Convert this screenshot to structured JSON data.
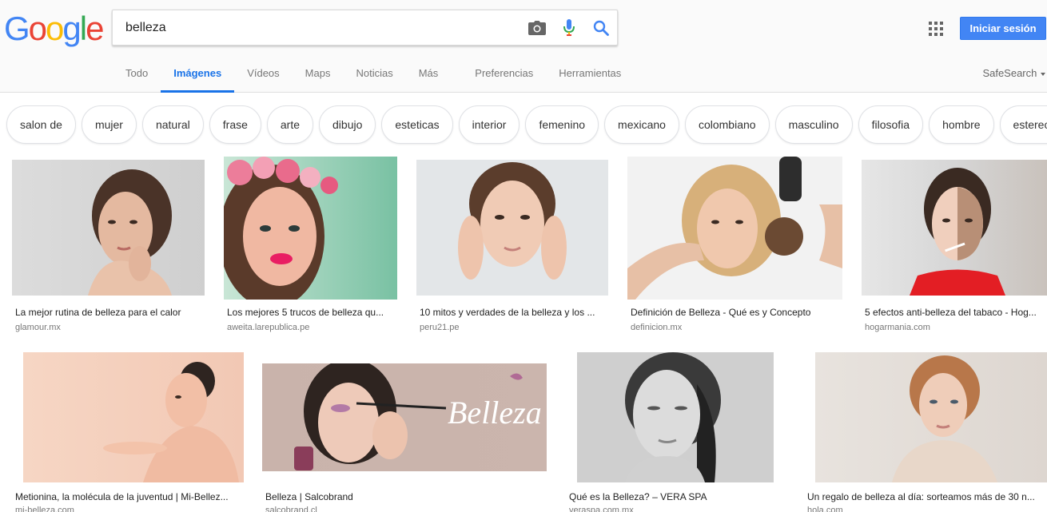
{
  "logo": {
    "letters": [
      "G",
      "o",
      "o",
      "g",
      "l",
      "e"
    ],
    "colors": [
      "#4285f4",
      "#ea4335",
      "#fbbc05",
      "#4285f4",
      "#34a853",
      "#ea4335"
    ]
  },
  "search": {
    "value": "belleza"
  },
  "header": {
    "signin_label": "Iniciar sesión",
    "safesearch_label": "SafeSearch"
  },
  "tabs": [
    {
      "label": "Todo"
    },
    {
      "label": "Imágenes",
      "active": true
    },
    {
      "label": "Vídeos"
    },
    {
      "label": "Maps"
    },
    {
      "label": "Noticias"
    },
    {
      "label": "Más"
    },
    {
      "label": "Preferencias"
    },
    {
      "label": "Herramientas"
    }
  ],
  "chips": [
    "salon de",
    "mujer",
    "natural",
    "frase",
    "arte",
    "dibujo",
    "esteticas",
    "interior",
    "femenino",
    "mexicano",
    "colombiano",
    "masculino",
    "filosofia",
    "hombre",
    "estereoti"
  ],
  "results": [
    {
      "title": "La mejor rutina de belleza para el calor",
      "source": "glamour.mx"
    },
    {
      "title": "Los mejores 5 trucos de belleza qu...",
      "source": "aweita.larepublica.pe"
    },
    {
      "title": "10 mitos y verdades de la belleza y los ...",
      "source": "peru21.pe"
    },
    {
      "title": "Definición de Belleza - Qué es y Concepto",
      "source": "definicion.mx"
    },
    {
      "title": "5 efectos anti-belleza del tabaco - Hog...",
      "source": "hogarmania.com"
    },
    {
      "title": "Metionina, la molécula de la juventud | Mi-Bellez...",
      "source": "mi-belleza.com"
    },
    {
      "title": "Belleza | Salcobrand",
      "source": "salcobrand.cl",
      "overlay_text": "Belleza"
    },
    {
      "title": "Qué es la Belleza? – VERA SPA",
      "source": "veraspa.com.mx"
    },
    {
      "title": "Un regalo de belleza al día: sorteamos más de 30 n...",
      "source": "hola.com"
    }
  ],
  "colors": {
    "accent": "#1a73e8",
    "signin": "#4285f4"
  }
}
